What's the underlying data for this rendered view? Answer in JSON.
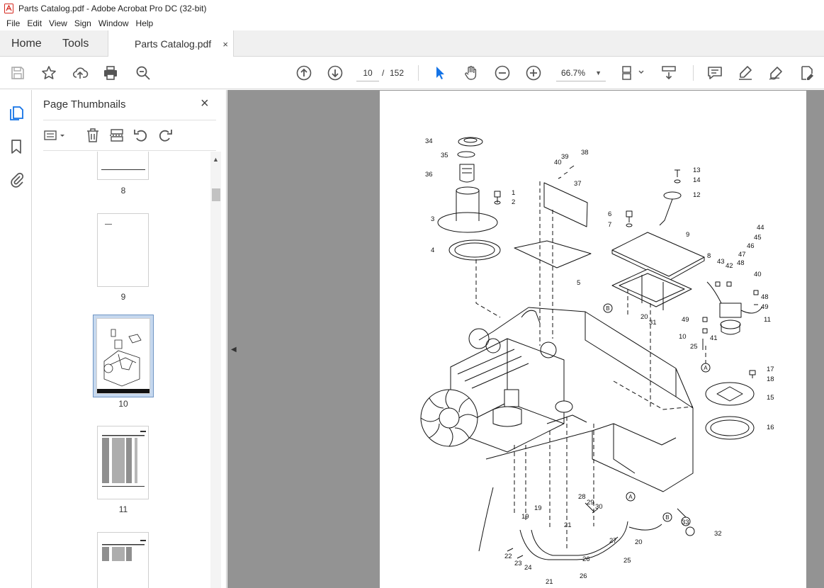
{
  "window": {
    "title": "Parts Catalog.pdf - Adobe Acrobat Pro DC (32-bit)"
  },
  "menu": [
    "File",
    "Edit",
    "View",
    "Sign",
    "Window",
    "Help"
  ],
  "tabs": {
    "home": "Home",
    "tools": "Tools",
    "document": "Parts Catalog.pdf",
    "close": "×"
  },
  "toolbar": {
    "current_page": "10",
    "page_separator": "/",
    "total_pages": "152",
    "zoom": "66.7%",
    "icons": [
      "save-icon",
      "star-icon",
      "upload-icon",
      "print-icon",
      "find-icon",
      "prev-page-icon",
      "next-page-icon",
      "select-cursor-icon",
      "hand-icon",
      "zoom-out-icon",
      "zoom-in-icon",
      "fit-page-icon",
      "scroll-mode-icon",
      "comment-icon",
      "highlight-icon",
      "sign-icon",
      "edit-pdf-icon"
    ]
  },
  "panel": {
    "title": "Page Thumbnails",
    "close": "×",
    "thumbnails": [
      {
        "page": "8"
      },
      {
        "page": "9"
      },
      {
        "page": "10",
        "selected": true
      },
      {
        "page": "11"
      }
    ]
  },
  "diagram": {
    "callouts": [
      "1",
      "2",
      "3",
      "4",
      "5",
      "6",
      "7",
      "8",
      "9",
      "10",
      "11",
      "12",
      "13",
      "14",
      "15",
      "16",
      "17",
      "18",
      "19",
      "19",
      "20",
      "20",
      "21",
      "21",
      "22",
      "23",
      "24",
      "25",
      "25",
      "26",
      "26",
      "27",
      "28",
      "29",
      "30",
      "31",
      "32",
      "33",
      "34",
      "35",
      "36",
      "37",
      "38",
      "39",
      "40",
      "40",
      "41",
      "42",
      "43",
      "44",
      "45",
      "46",
      "47",
      "48",
      "48",
      "49",
      "49"
    ],
    "circle_labels": [
      "A",
      "A",
      "B",
      "B"
    ]
  },
  "colors": {
    "accent": "#1473e6",
    "doc_bg": "#939393",
    "selection": "#c6d8ee"
  }
}
